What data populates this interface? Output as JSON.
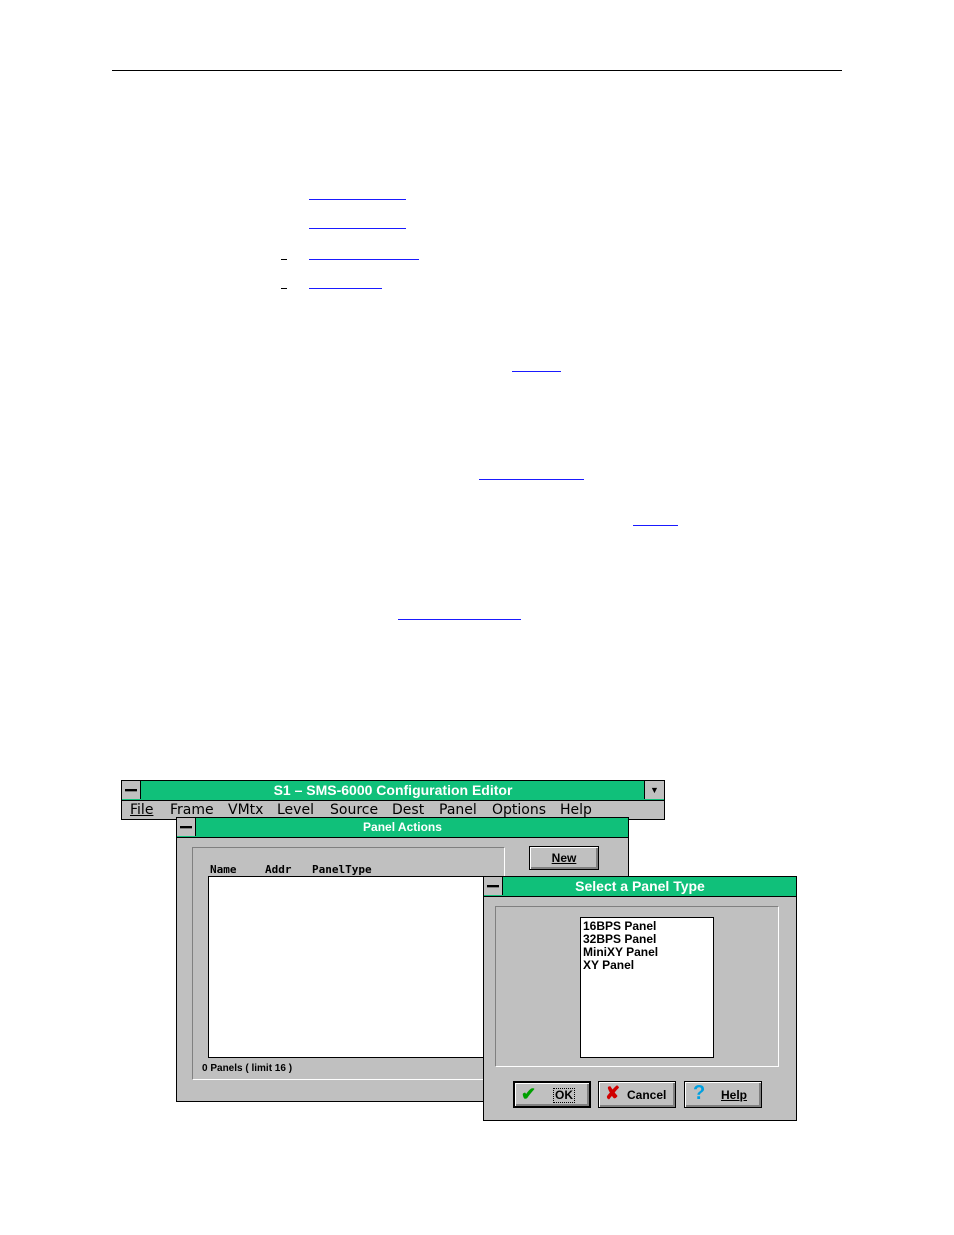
{
  "main_window": {
    "title": "S1  –  SMS-6000 Configuration Editor",
    "menu": [
      "File",
      "Frame",
      "VMtx",
      "Level",
      "Source",
      "Dest",
      "Panel",
      "Options",
      "Help"
    ]
  },
  "panel_actions": {
    "title": "Panel Actions",
    "columns": [
      "Name",
      "Addr",
      "PanelType"
    ],
    "new_label": "New",
    "status": "0 Panels ( limit 16 )"
  },
  "select_panel": {
    "title": "Select a Panel Type",
    "options": [
      "16BPS Panel",
      "32BPS Panel",
      "MiniXY Panel",
      "XY Panel"
    ],
    "ok_label": "OK",
    "cancel_label": "Cancel",
    "help_label": "Help"
  },
  "colors": {
    "titlebar": "#10c07a",
    "window_face": "#c0c0c0",
    "link": "#1a1aff"
  },
  "icons": [
    "system-menu-icon",
    "dropdown-arrow-icon",
    "checkmark-icon",
    "x-icon",
    "question-mark-icon"
  ]
}
